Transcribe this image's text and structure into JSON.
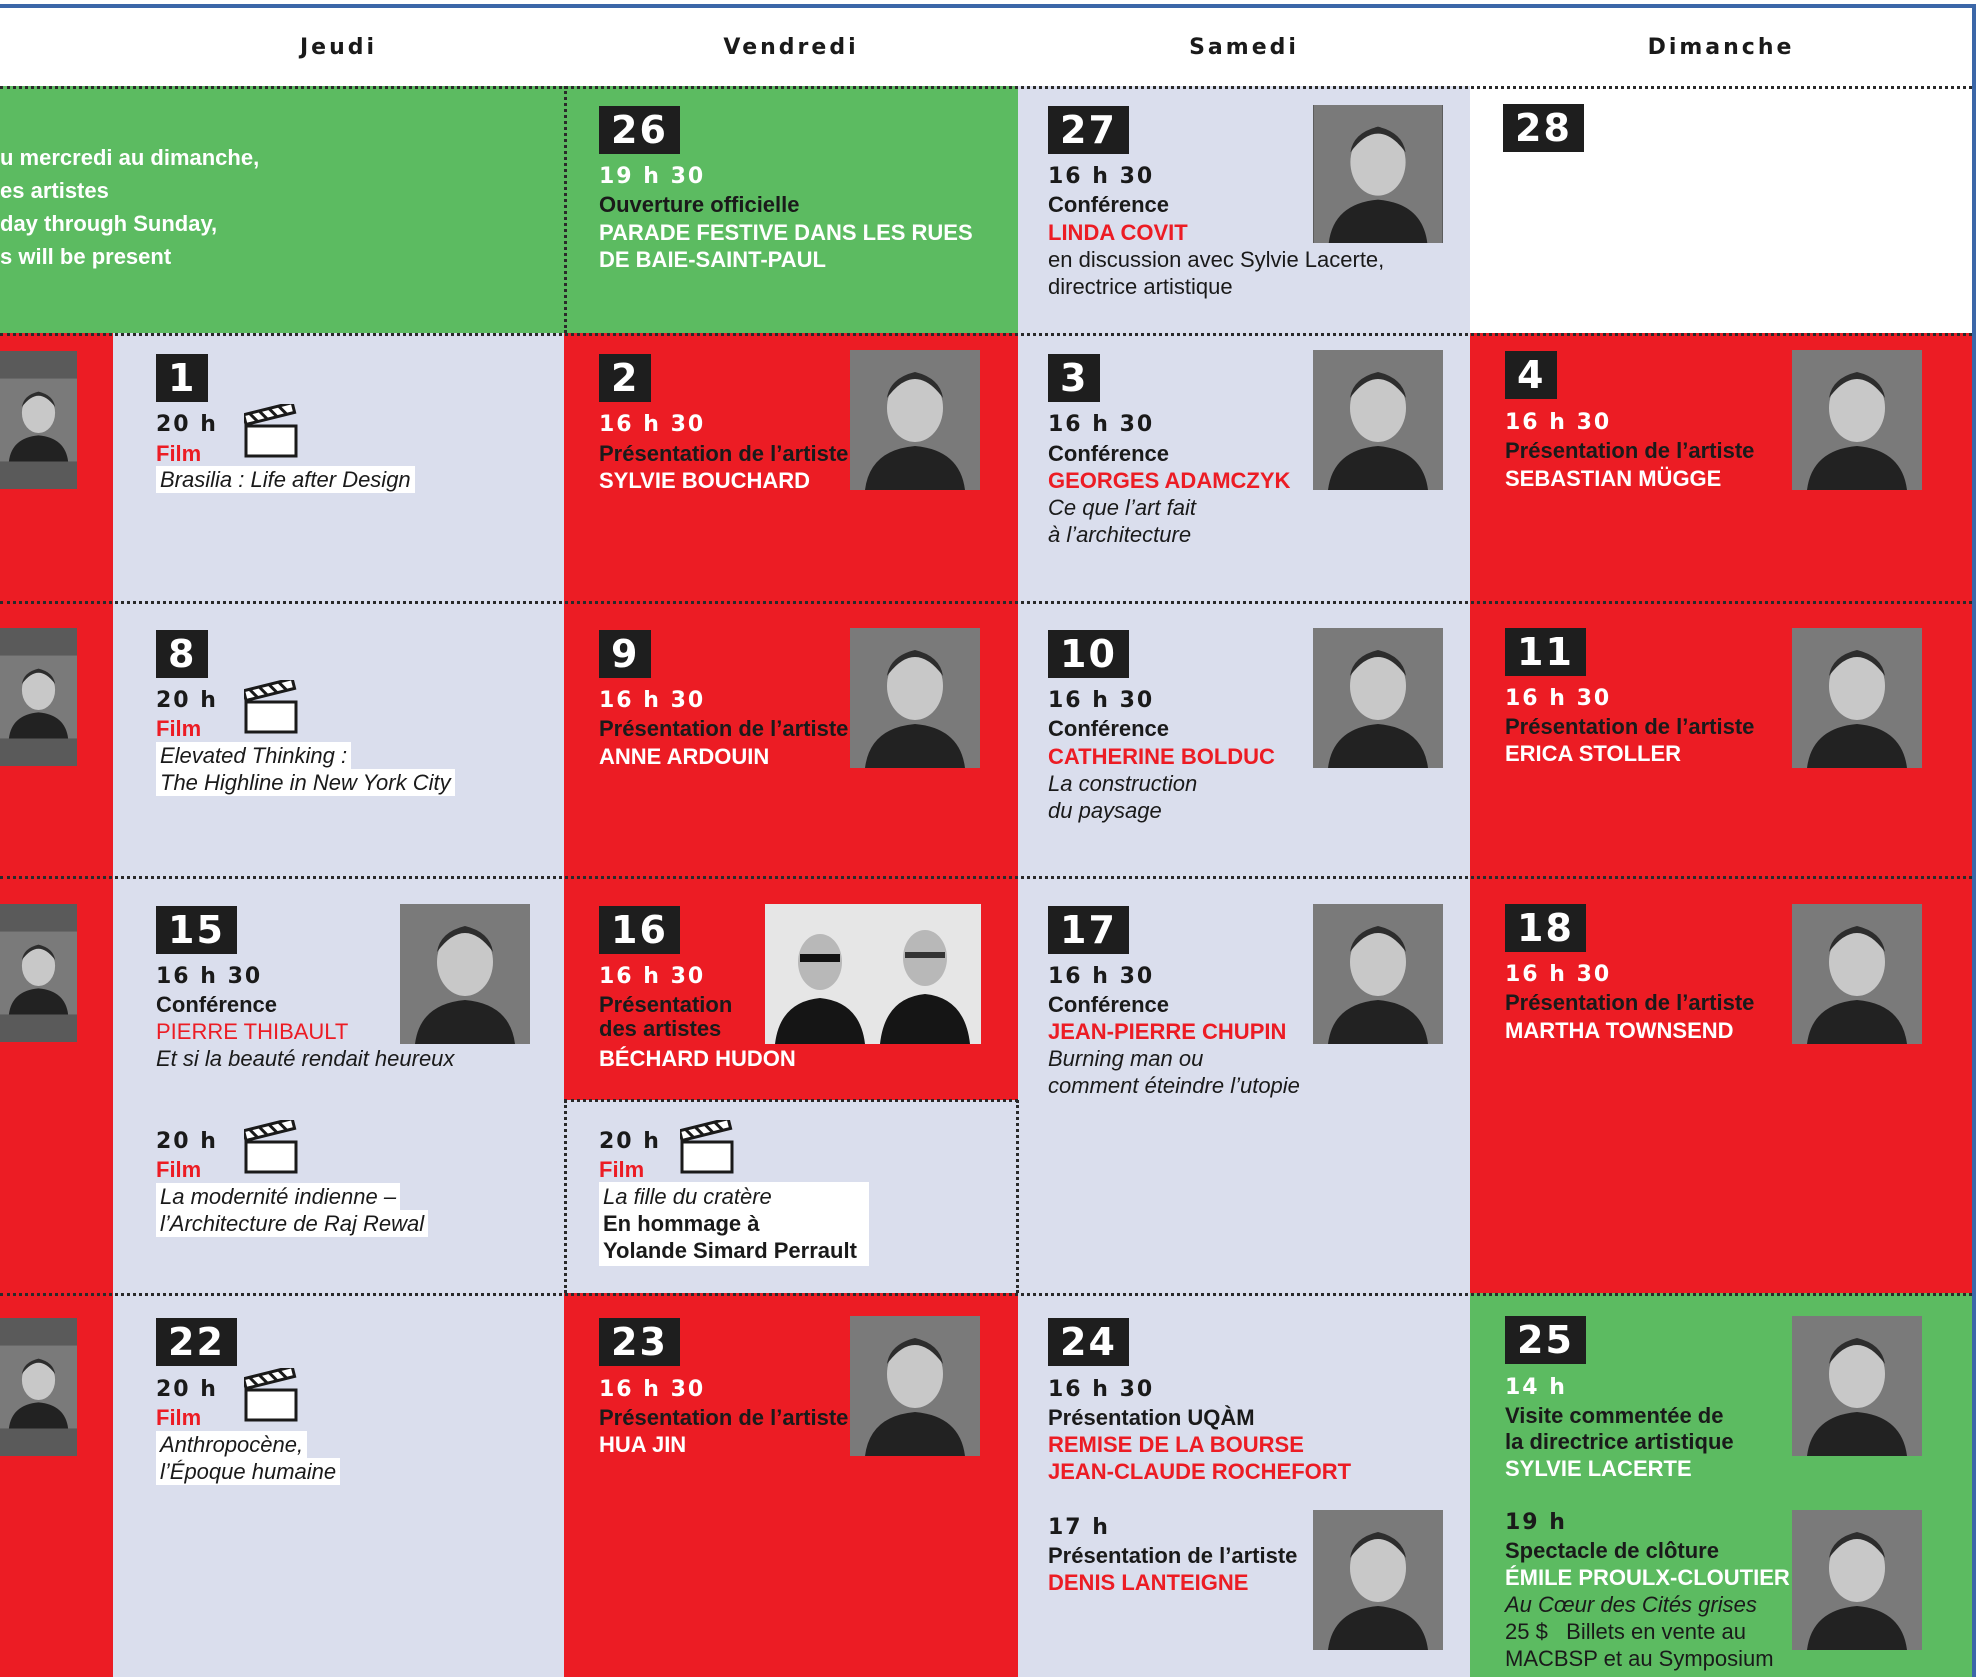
{
  "days": {
    "jeudi": "Jeudi",
    "vendredi": "Vendredi",
    "samedi": "Samedi",
    "dimanche": "Dimanche"
  },
  "colors": {
    "red": "#ec1c24",
    "grey": "#dadeed",
    "green": "#5cbb61",
    "dark": "#1e1e1e",
    "border": "#3b67a8"
  },
  "intro": {
    "lines": [
      "u mercredi au dimanche,",
      "es artistes",
      "day through Sunday,",
      "s will be present"
    ]
  },
  "row0": {
    "fri": {
      "day": "26",
      "time": "19 h 30",
      "type": "Ouverture officielle",
      "title1": "PARADE FESTIVE DANS LES RUES",
      "title2": "DE BAIE-SAINT-PAUL"
    },
    "sat": {
      "day": "27",
      "time": "16 h 30",
      "type": "Conférence",
      "name": "LINDA COVIT",
      "desc1": "en discussion avec Sylvie Lacerte,",
      "desc2": "directrice artistique",
      "photo": "portrait-linda-covit"
    },
    "sun": {
      "day": "28"
    }
  },
  "row1": {
    "thu": {
      "day": "1",
      "time": "20 h",
      "type": "Film",
      "title": "Brasilia : Life after Design",
      "icon": "film-clapperboard-icon"
    },
    "fri": {
      "day": "2",
      "time": "16 h 30",
      "type": "Présentation de l’artiste",
      "name": "SYLVIE BOUCHARD",
      "photo": "portrait-sylvie-bouchard"
    },
    "sat": {
      "day": "3",
      "time": "16 h 30",
      "type": "Conférence",
      "name": "GEORGES ADAMCZYK",
      "desc1": "Ce que l’art fait",
      "desc2": "à l’architecture",
      "photo": "portrait-georges-adamczyk"
    },
    "sun": {
      "day": "4",
      "time": "16 h 30",
      "type": "Présentation de l’artiste",
      "name": "SEBASTIAN MÜGGE",
      "photo": "portrait-sebastian-mugge"
    }
  },
  "row2": {
    "thu": {
      "day": "8",
      "time": "20 h",
      "type": "Film",
      "title1": "Elevated Thinking :",
      "title2": "The Highline in New York City",
      "icon": "film-clapperboard-icon"
    },
    "fri": {
      "day": "9",
      "time": "16 h 30",
      "type": "Présentation de l’artiste",
      "name": "ANNE ARDOUIN",
      "photo": "portrait-anne-ardouin"
    },
    "sat": {
      "day": "10",
      "time": "16 h 30",
      "type": "Conférence",
      "name": "CATHERINE BOLDUC",
      "desc1": "La construction",
      "desc2": "du paysage",
      "photo": "portrait-catherine-bolduc"
    },
    "sun": {
      "day": "11",
      "time": "16 h 30",
      "type": "Présentation de l’artiste",
      "name": "ERICA STOLLER",
      "photo": "portrait-erica-stoller"
    }
  },
  "row3": {
    "thu": {
      "day": "15",
      "time": "16 h 30",
      "type": "Conférence",
      "name": "PIERRE THIBAULT",
      "desc": "Et si la beauté rendait heureux",
      "time2": "20 h",
      "type2": "Film",
      "title1": "La modernité indienne –",
      "title2": "l’Architecture de Raj Rewal",
      "photo": "portrait-pierre-thibault"
    },
    "fri": {
      "day": "16",
      "time": "16 h 30",
      "type1": "Présentation",
      "type2": "des artistes",
      "name": "BÉCHARD HUDON",
      "time2": "20 h",
      "filmtype": "Film",
      "title1": "La fille du cratère",
      "title2": "En hommage à",
      "title3": "Yolande Simard Perrault",
      "photo": "portrait-bechard-hudon"
    },
    "sat": {
      "day": "17",
      "time": "16 h 30",
      "type": "Conférence",
      "name": "JEAN-PIERRE CHUPIN",
      "desc1": "Burning man ou",
      "desc2": "comment éteindre l’utopie",
      "photo": "portrait-jean-pierre-chupin"
    },
    "sun": {
      "day": "18",
      "time": "16 h 30",
      "type": "Présentation de l’artiste",
      "name": "MARTHA TOWNSEND",
      "photo": "portrait-martha-townsend"
    }
  },
  "row4": {
    "thu": {
      "day": "22",
      "time": "20 h",
      "type": "Film",
      "title1": "Anthropocène,",
      "title2": "l’Époque humaine",
      "icon": "film-clapperboard-icon"
    },
    "fri": {
      "day": "23",
      "time": "16 h 30",
      "type": "Présentation de l’artiste",
      "name": "HUA JIN",
      "photo": "portrait-hua-jin"
    },
    "sat": {
      "day": "24",
      "time": "16 h 30",
      "type": "Présentation UQÀM",
      "name1": "REMISE DE LA BOURSE",
      "name2": "JEAN-CLAUDE ROCHEFORT",
      "time2": "17 h",
      "type2": "Présentation de l’artiste",
      "name3": "DENIS LANTEIGNE",
      "photo": "portrait-denis-lanteigne"
    },
    "sun": {
      "day": "25",
      "time": "14 h",
      "type1": "Visite commentée de",
      "type2": "la directrice artistique",
      "name": "SYLVIE LACERTE",
      "time2": "19 h",
      "type3": "Spectacle de clôture",
      "name2": "ÉMILE PROULX-CLOUTIER",
      "desc": "Au Cœur des Cités grises",
      "price": "25 $   Billets en vente au",
      "venue": "MACBSP et au Symposium",
      "photo1": "portrait-sylvie-lacerte",
      "photo2": "portrait-emile-proulx-cloutier"
    }
  }
}
